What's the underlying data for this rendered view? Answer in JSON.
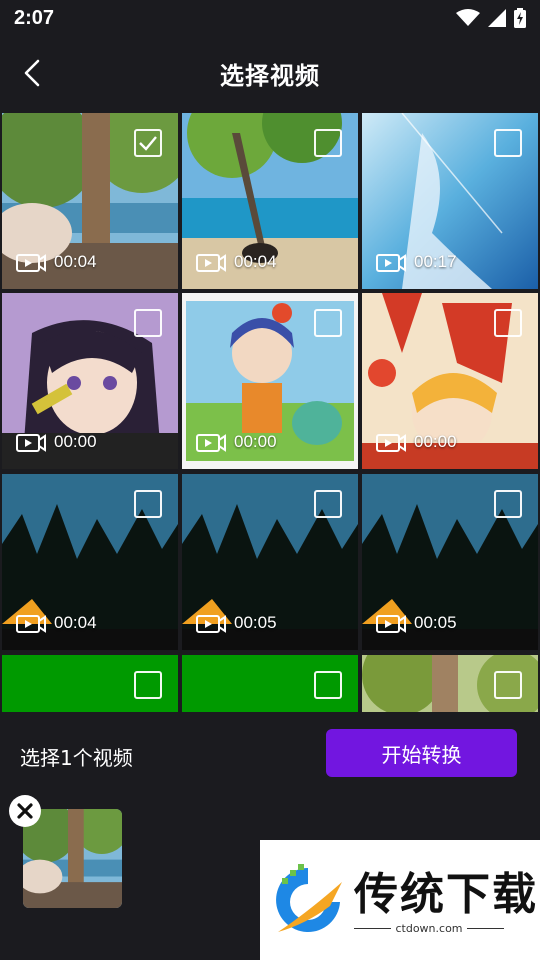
{
  "status_bar": {
    "time": "2:07"
  },
  "header": {
    "title": "选择视频"
  },
  "videos": [
    {
      "duration": "00:04",
      "checked": true
    },
    {
      "duration": "00:04",
      "checked": false
    },
    {
      "duration": "00:17",
      "checked": false
    },
    {
      "duration": "00:00",
      "checked": false
    },
    {
      "duration": "00:00",
      "checked": false
    },
    {
      "duration": "00:00",
      "checked": false
    },
    {
      "duration": "00:04",
      "checked": false
    },
    {
      "duration": "00:05",
      "checked": false
    },
    {
      "duration": "00:05",
      "checked": false
    },
    {
      "duration": "",
      "checked": false
    },
    {
      "duration": "",
      "checked": false
    },
    {
      "duration": "",
      "checked": false
    }
  ],
  "bottom": {
    "selected_count": "选择1个视频",
    "start_button": "开始转换"
  },
  "watermark": {
    "brand": "传统下载",
    "url": "ctdown.com"
  },
  "colors": {
    "accent": "#7216e0",
    "background": "#1b1b1f"
  }
}
